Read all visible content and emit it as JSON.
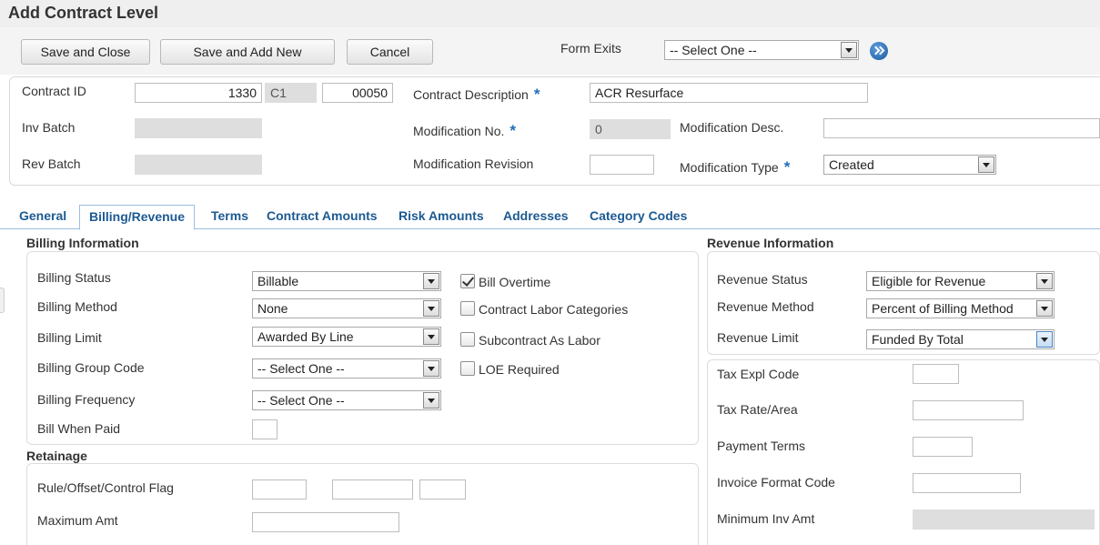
{
  "title": "Add Contract Level",
  "toolbar": {
    "save_close": "Save and Close",
    "save_add_new": "Save and Add New",
    "cancel": "Cancel",
    "form_exits_label": "Form Exits",
    "form_exits_value": "-- Select One --"
  },
  "header": {
    "contract_id_label": "Contract ID",
    "contract_id_1": "1330",
    "contract_id_2": "C1",
    "contract_id_3": "00050",
    "contract_desc_label": "Contract Description",
    "contract_desc_value": "ACR Resurface",
    "inv_batch_label": "Inv Batch",
    "inv_batch_value": "",
    "mod_no_label": "Modification No.",
    "mod_no_value": "0",
    "mod_desc_label": "Modification Desc.",
    "mod_desc_value": "",
    "rev_batch_label": "Rev Batch",
    "rev_batch_value": "",
    "mod_rev_label": "Modification Revision",
    "mod_rev_value": "",
    "mod_type_label": "Modification Type",
    "mod_type_value": "Created",
    "required_mark": "*"
  },
  "tabs": [
    "General",
    "Billing/Revenue",
    "Terms",
    "Contract Amounts",
    "Risk Amounts",
    "Addresses",
    "Category Codes"
  ],
  "billing": {
    "section_title": "Billing Information",
    "status_label": "Billing Status",
    "status_value": "Billable",
    "method_label": "Billing Method",
    "method_value": "None",
    "limit_label": "Billing Limit",
    "limit_value": "Awarded By Line",
    "group_code_label": "Billing Group Code",
    "group_code_value": "-- Select One --",
    "frequency_label": "Billing Frequency",
    "frequency_value": "-- Select One --",
    "bill_when_paid_label": "Bill When Paid",
    "bill_when_paid_value": "",
    "bill_overtime_label": "Bill Overtime",
    "bill_overtime_checked": true,
    "contract_labor_label": "Contract Labor Categories",
    "contract_labor_checked": false,
    "subcontract_label": "Subcontract As Labor",
    "subcontract_checked": false,
    "loe_label": "LOE Required",
    "loe_checked": false
  },
  "retainage": {
    "section_title": "Retainage",
    "rule_label": "Rule/Offset/Control Flag",
    "rule_value_1": "",
    "rule_value_2": "",
    "rule_value_3": "",
    "max_amt_label": "Maximum Amt",
    "max_amt_value": ""
  },
  "revenue": {
    "section_title": "Revenue Information",
    "status_label": "Revenue Status",
    "status_value": "Eligible for Revenue",
    "method_label": "Revenue Method",
    "method_value": "Percent of Billing Method",
    "limit_label": "Revenue Limit",
    "limit_value": "Funded By Total"
  },
  "tax": {
    "expl_code_label": "Tax Expl Code",
    "expl_code_value": "",
    "rate_area_label": "Tax Rate/Area",
    "rate_area_value": "",
    "payment_terms_label": "Payment Terms",
    "payment_terms_value": "",
    "invoice_format_label": "Invoice Format Code",
    "invoice_format_value": "",
    "min_inv_label": "Minimum Inv Amt",
    "min_inv_value": ""
  }
}
